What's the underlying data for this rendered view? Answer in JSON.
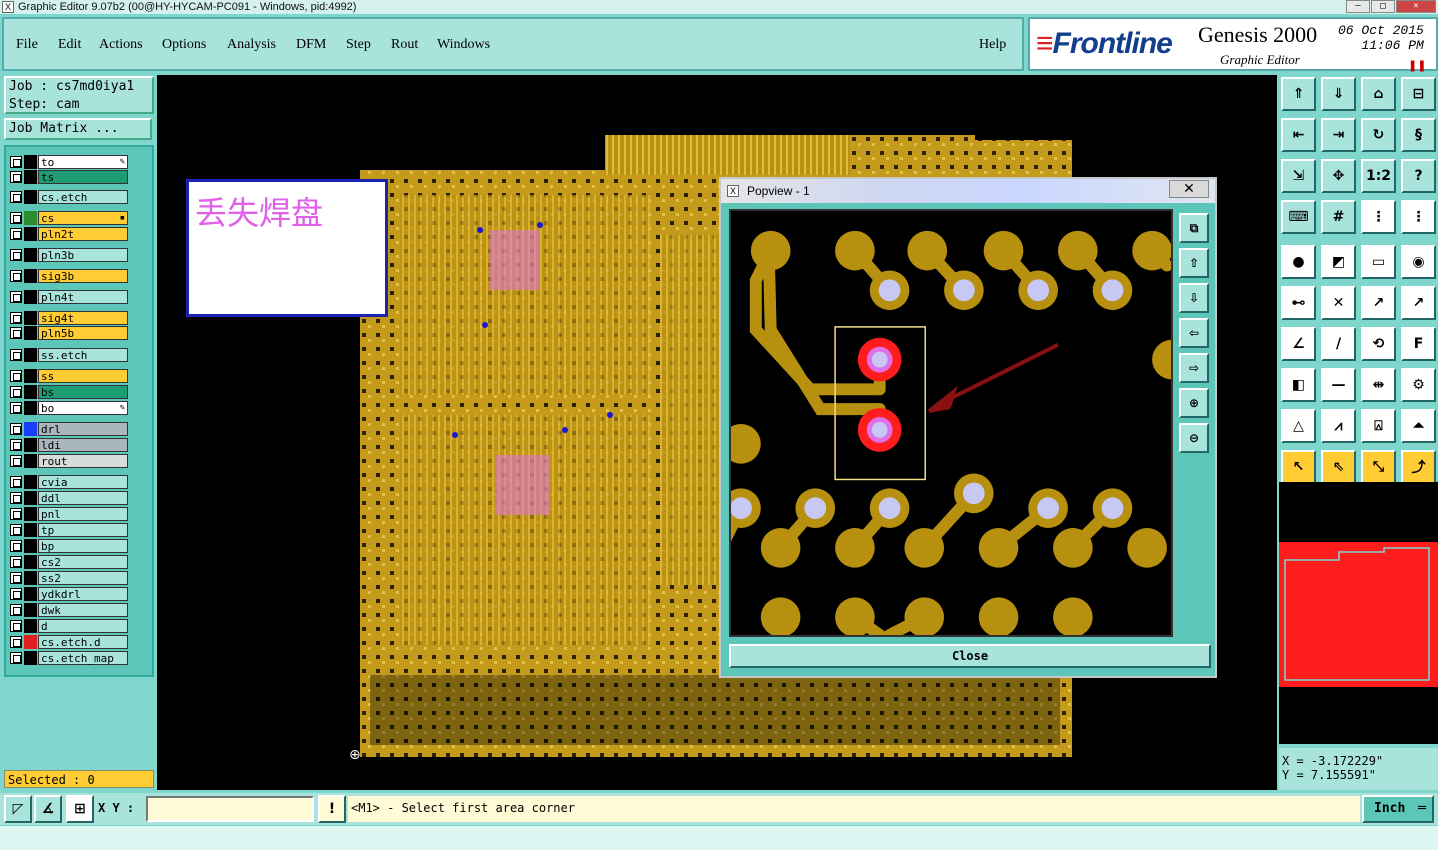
{
  "window": {
    "title": "Graphic Editor 9.07b2 (00@HY-HYCAM-PC091 - Windows, pid:4992)"
  },
  "menu": [
    {
      "label": "File"
    },
    {
      "label": "Edit"
    },
    {
      "label": "Actions"
    },
    {
      "label": "Options"
    },
    {
      "label": "Analysis"
    },
    {
      "label": "DFM"
    },
    {
      "label": "Step"
    },
    {
      "label": "Rout"
    },
    {
      "label": "Windows"
    },
    {
      "label": "Help"
    }
  ],
  "branding": {
    "logo": "Frontline",
    "product": "Genesis 2000",
    "subtitle": "Graphic Editor",
    "date": "06 Oct 2015",
    "time": "11:06 PM"
  },
  "job": {
    "job_line": "Job : cs7md0iya1",
    "step_line": "Step: cam",
    "matrix_button": "Job Matrix ..."
  },
  "layers": [
    {
      "name": "to",
      "color": "#ffffff",
      "swatch": "#000000",
      "flag": "✎"
    },
    {
      "name": "ts",
      "color": "#1e9c74",
      "swatch": "#000000"
    },
    {
      "name": "cs.etch",
      "color": "#a8e3dc",
      "swatch": "#000000"
    },
    {
      "name": "cs",
      "color": "#ffcc33",
      "swatch": "#2e8b2e",
      "flag": "▪"
    },
    {
      "name": "pln2t",
      "color": "#ffcc33",
      "swatch": "#000000"
    },
    {
      "name": "pln3b",
      "color": "#a8e3dc",
      "swatch": "#000000"
    },
    {
      "name": "sig3b",
      "color": "#ffcc33",
      "swatch": "#000000"
    },
    {
      "name": "pln4t",
      "color": "#a8e3dc",
      "swatch": "#000000"
    },
    {
      "name": "sig4t",
      "color": "#ffcc33",
      "swatch": "#000000"
    },
    {
      "name": "pln5b",
      "color": "#ffcc33",
      "swatch": "#000000"
    },
    {
      "name": "ss.etch",
      "color": "#a8e3dc",
      "swatch": "#000000"
    },
    {
      "name": "ss",
      "color": "#ffcc33",
      "swatch": "#000000"
    },
    {
      "name": "bs",
      "color": "#1e9c74",
      "swatch": "#000000"
    },
    {
      "name": "bo",
      "color": "#ffffff",
      "swatch": "#000000",
      "flag": "✎"
    },
    {
      "name": "drl",
      "color": "#a9b7bc",
      "swatch": "#1a3cff"
    },
    {
      "name": "ldi",
      "color": "#a9b7bc",
      "swatch": "#000000"
    },
    {
      "name": "rout",
      "color": "#d8dcdc",
      "swatch": "#000000"
    },
    {
      "name": "cvia",
      "color": "#a8e3dc",
      "swatch": "#000000"
    },
    {
      "name": "ddl",
      "color": "#a8e3dc",
      "swatch": "#000000"
    },
    {
      "name": "pnl",
      "color": "#a8e3dc",
      "swatch": "#000000"
    },
    {
      "name": "tp",
      "color": "#a8e3dc",
      "swatch": "#000000"
    },
    {
      "name": "bp",
      "color": "#a8e3dc",
      "swatch": "#000000"
    },
    {
      "name": "cs2",
      "color": "#a8e3dc",
      "swatch": "#000000"
    },
    {
      "name": "ss2",
      "color": "#a8e3dc",
      "swatch": "#000000"
    },
    {
      "name": "ydkdrl",
      "color": "#a8e3dc",
      "swatch": "#000000"
    },
    {
      "name": "dwk",
      "color": "#a8e3dc",
      "swatch": "#000000"
    },
    {
      "name": "d",
      "color": "#a8e3dc",
      "swatch": "#000000"
    },
    {
      "name": "cs.etch.d",
      "color": "#a8e3dc",
      "swatch": "#e02020"
    },
    {
      "name": "cs.etch_map",
      "color": "#a8e3dc",
      "swatch": "#000000"
    }
  ],
  "annotation": {
    "text": "丢失焊盘"
  },
  "popview": {
    "title": "Popview - 1",
    "close_x": "✕",
    "close_button": "Close"
  },
  "selection": {
    "text": "Selected : 0"
  },
  "coordinates": {
    "x": "X = -3.172229\"",
    "y": "Y = 7.155591\""
  },
  "statusbar": {
    "xy_label": "X Y :",
    "xy_value": "",
    "prompt": "<M1> - Select first area corner",
    "units": "Inch",
    "alert_icon": "!"
  }
}
